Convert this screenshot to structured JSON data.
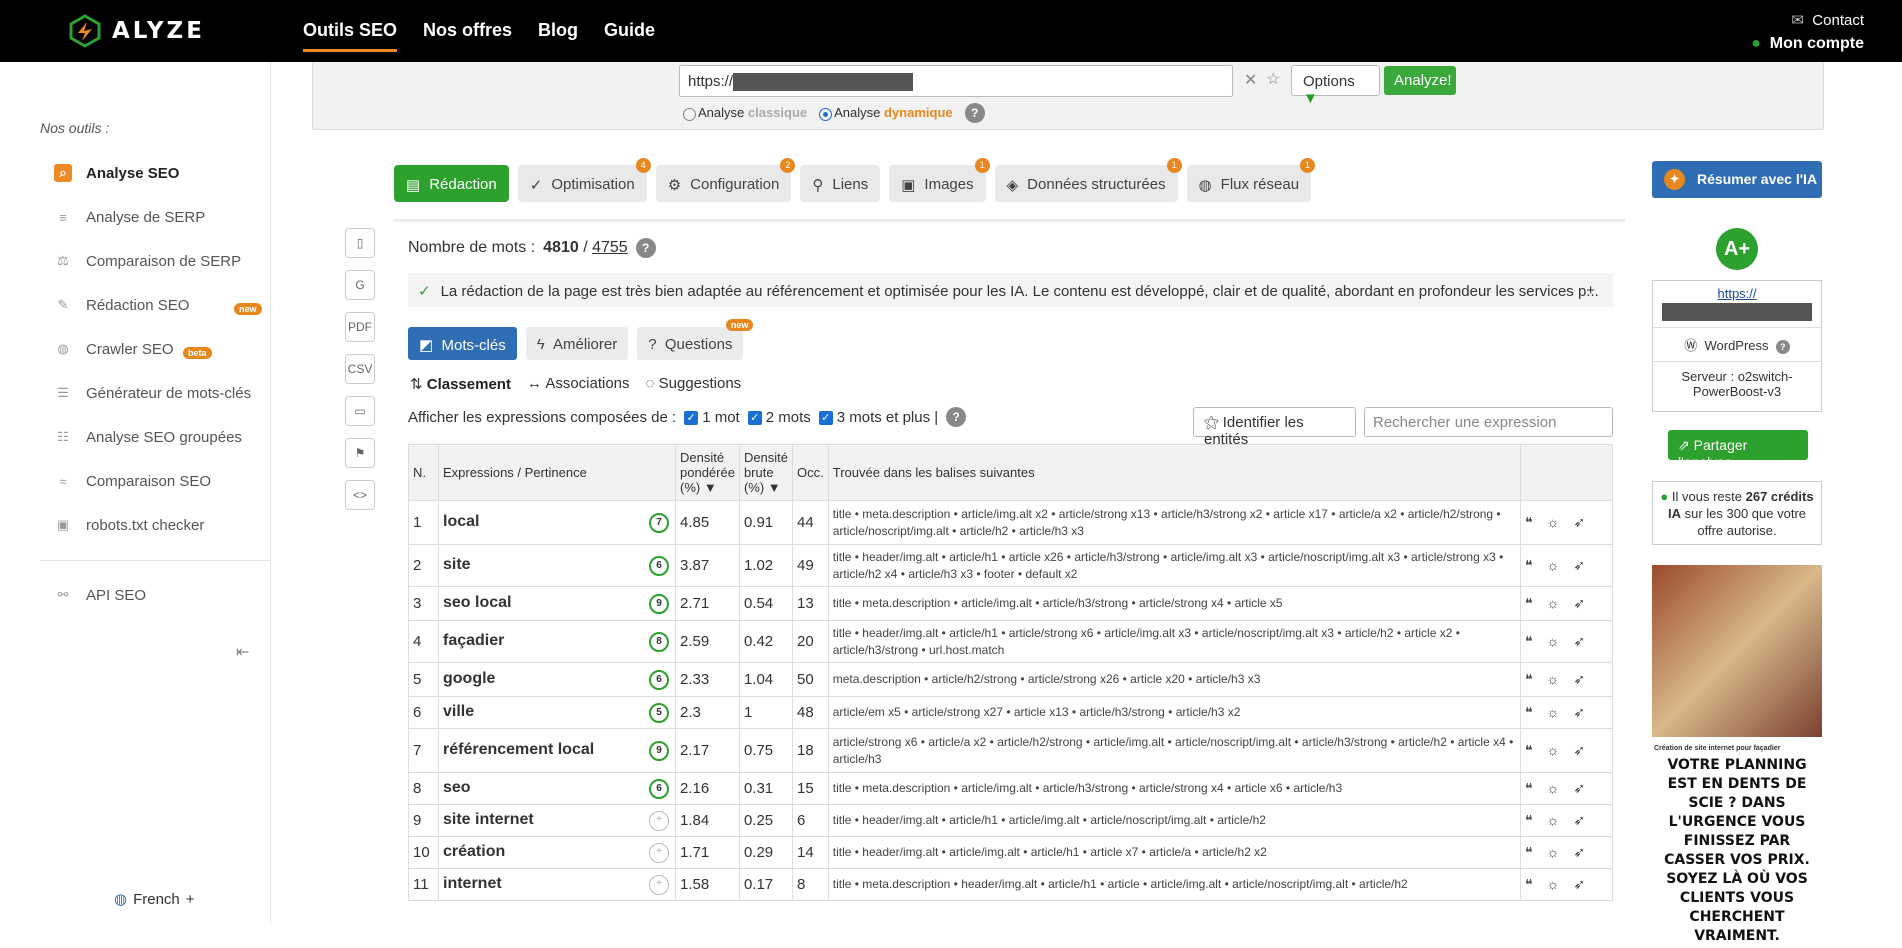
{
  "header": {
    "brand": "ALYZE",
    "nav": [
      "Outils SEO",
      "Nos offres",
      "Blog",
      "Guide"
    ],
    "contact": "Contact",
    "account": "Mon compte"
  },
  "sidebar": {
    "title": "Nos outils :",
    "items": [
      "Analyse SEO",
      "Analyse de SERP",
      "Comparaison de SERP",
      "Rédaction SEO",
      "Crawler SEO",
      "Générateur de mots-clés",
      "Analyse SEO groupées",
      "Comparaison SEO",
      "robots.txt checker"
    ],
    "api": "API SEO",
    "badge_new": "new",
    "badge_beta": "beta",
    "language": "French"
  },
  "search": {
    "url_prefix": "https://",
    "options": "Options",
    "analyze": "Analyze!",
    "radio1": "Analyse",
    "radio1_em": "classique",
    "radio2": "Analyse",
    "radio2_em": "dynamique"
  },
  "tabs": [
    {
      "label": "Rédaction",
      "count": ""
    },
    {
      "label": "Optimisation",
      "count": "4"
    },
    {
      "label": "Configuration",
      "count": "2"
    },
    {
      "label": "Liens",
      "count": ""
    },
    {
      "label": "Images",
      "count": "1"
    },
    {
      "label": "Données structurées",
      "count": "1"
    },
    {
      "label": "Flux réseau",
      "count": "1"
    }
  ],
  "wordcount": {
    "label": "Nombre de mots :",
    "value": "4810",
    "total": "4755"
  },
  "notice": "La rédaction de la page est très bien adaptée au référencement et optimisée pour les IA. Le contenu est développé, clair et de qualité, abordant en profondeur les services p...",
  "subtabs": [
    "Mots-clés",
    "Améliorer",
    "Questions"
  ],
  "views": [
    "Classement",
    "Associations",
    "Suggestions"
  ],
  "filters": {
    "label": "Afficher les expressions composées de :",
    "o1": "1 mot",
    "o2": "2 mots",
    "o3": "3 mots et plus |"
  },
  "entities": "Identifier les entités",
  "search_placeholder": "Rechercher une expression",
  "table": {
    "headers": [
      "N.",
      "Expressions / Pertinence",
      "Densité pondérée (%) ▼",
      "Densité brute (%) ▼",
      "Occ.",
      "Trouvée dans les balises suivantes"
    ],
    "rows": [
      [
        "1",
        "local",
        "7",
        "4.85",
        "0.91",
        "44",
        "title • meta.description • article/img.alt x2 • article/strong x13 • article/h3/strong x2 • article x17 • article/a x2 • article/h2/strong • article/noscript/img.alt • article/h2 • article/h3 x3"
      ],
      [
        "2",
        "site",
        "6",
        "3.87",
        "1.02",
        "49",
        "title • header/img.alt • article/h1 • article x26 • article/h3/strong • article/img.alt x3 • article/noscript/img.alt x3 • article/strong x3 • article/h2 x4 • article/h3 x3 • footer • default x2"
      ],
      [
        "3",
        "seo local",
        "9",
        "2.71",
        "0.54",
        "13",
        "title • meta.description • article/img.alt • article/h3/strong • article/strong x4 • article x5"
      ],
      [
        "4",
        "façadier",
        "8",
        "2.59",
        "0.42",
        "20",
        "title • header/img.alt • article/h1 • article/strong x6 • article/img.alt x3 • article/noscript/img.alt x3 • article/h2 • article x2 • article/h3/strong • url.host.match"
      ],
      [
        "5",
        "google",
        "6",
        "2.33",
        "1.04",
        "50",
        "meta.description • article/h2/strong • article/strong x26 • article x20 • article/h3 x3"
      ],
      [
        "6",
        "ville",
        "5",
        "2.3",
        "1",
        "48",
        "article/em x5 • article/strong x27 • article x13 • article/h3/strong • article/h3 x2"
      ],
      [
        "7",
        "référencement local",
        "9",
        "2.17",
        "0.75",
        "18",
        "article/strong x6 • article/a x2 • article/h2/strong • article/img.alt • article/noscript/img.alt • article/h3/strong • article/h2 • article x4 • article/h3"
      ],
      [
        "8",
        "seo",
        "6",
        "2.16",
        "0.31",
        "15",
        "title • meta.description • article/img.alt • article/h3/strong • article/strong x4 • article x6 • article/h3"
      ],
      [
        "9",
        "site internet",
        "+",
        "1.84",
        "0.25",
        "6",
        "title • header/img.alt • article/h1 • article/img.alt • article/noscript/img.alt • article/h2"
      ],
      [
        "10",
        "création",
        "+",
        "1.71",
        "0.29",
        "14",
        "title • header/img.alt • article/img.alt • article/h1 • article x7 • article/a • article/h2 x2"
      ],
      [
        "11",
        "internet",
        "+",
        "1.58",
        "0.17",
        "8",
        "title • meta.description • header/img.alt • article/h1 • article • article/img.alt • article/noscript/img.alt • article/h2"
      ]
    ]
  },
  "right": {
    "ia_button": "Résumer avec l'IA",
    "grade": "A+",
    "site_url": "https://",
    "cms": "WordPress",
    "server": "Serveur : o2switch-PowerBoost-v3",
    "share": "Partager l'analyse",
    "credits_pre": "Il vous reste",
    "credits_val": "267 crédits IA",
    "credits_post": "sur les 300 que votre offre autorise.",
    "ad_small": "Création de site internet pour façadier",
    "ad_text": "VOTRE PLANNING EST EN DENTS DE SCIE ? DANS L'URGENCE VOUS FINISSEZ PAR CASSER VOS PRIX. SOYEZ LÀ OÙ VOS CLIENTS VOUS CHERCHENT VRAIMENT."
  },
  "colors": {
    "accent": "#f08a24",
    "green": "#2da12e",
    "blue": "#2f6db5"
  }
}
